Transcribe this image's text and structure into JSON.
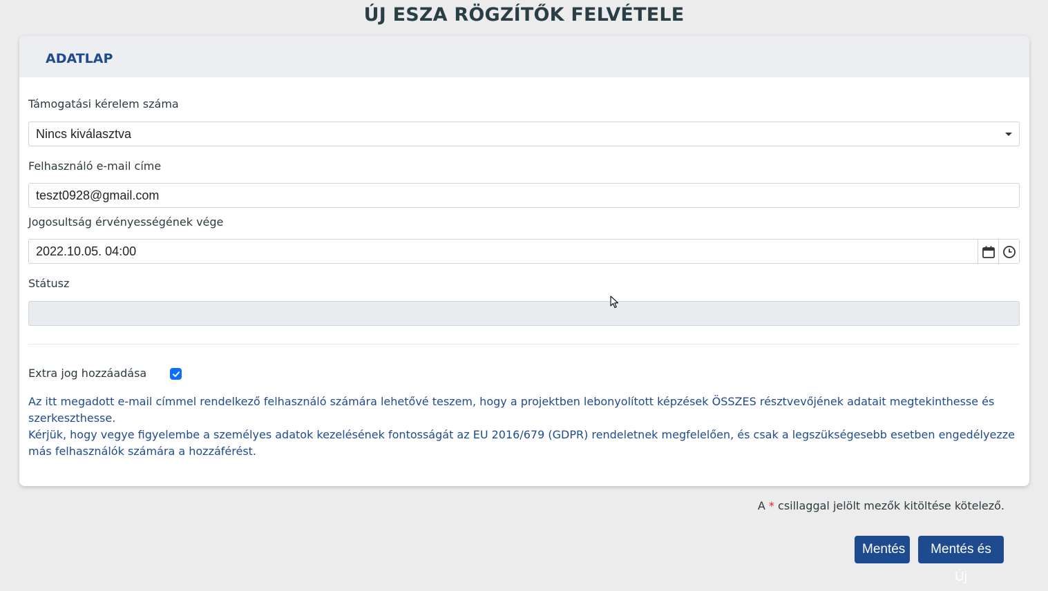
{
  "page": {
    "title": "ÚJ ESZA RÖGZÍTŐK FELVÉTELE"
  },
  "card": {
    "header_title": "ADATLAP"
  },
  "fields": {
    "application_number": {
      "label": "Támogatási kérelem száma",
      "selected": "Nincs kiválasztva"
    },
    "email": {
      "label": "Felhasználó e-mail címe",
      "value": "teszt0928@gmail.com"
    },
    "expiry": {
      "label": "Jogosultság érvényességének vége",
      "value": "2022.10.05. 04:00"
    },
    "status": {
      "label": "Státusz",
      "value": ""
    }
  },
  "extra_right": {
    "label": "Extra jog hozzáadása",
    "checked": true
  },
  "info": {
    "line1": "Az itt megadott e-mail címmel rendelkező felhasználó számára lehetővé teszem, hogy a projektben lebonyolított képzések ÖSSZES résztvevőjének adatait megtekinthesse és szerkeszthesse.",
    "line2": "Kérjük, hogy vegye figyelembe a személyes adatok kezelésének fontosságát az EU 2016/679 (GDPR) rendeletnek megfelelően, és csak a legszükségesebb esetben engedélyezze más felhasználók számára a hozzáférést."
  },
  "required_note": {
    "prefix": "A",
    "star": "*",
    "suffix": "csillaggal jelölt mezők kitöltése kötelező."
  },
  "buttons": {
    "save": "Mentés",
    "save_new": "Mentés és Új"
  },
  "colors": {
    "primary": "#1e4b8f",
    "title": "#2a3f45",
    "required_star": "#d9262c",
    "checkbox": "#0d6efd"
  },
  "icons": {
    "select_caret": "chevron-down-icon",
    "calendar": "calendar-icon",
    "clock": "clock-icon",
    "checkbox": "check-icon",
    "cursor": "mouse-cursor-icon"
  }
}
